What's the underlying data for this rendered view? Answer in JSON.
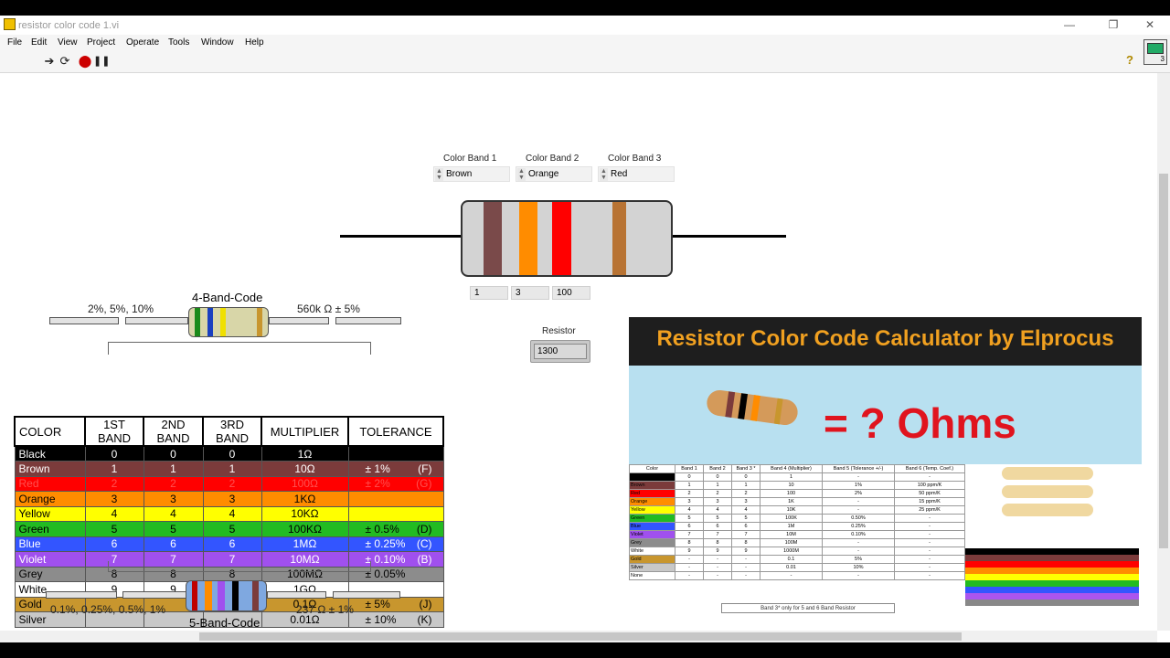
{
  "window": {
    "title": "resistor color code 1.vi"
  },
  "menu": [
    "File",
    "Edit",
    "View",
    "Project",
    "Operate",
    "Tools",
    "Window",
    "Help"
  ],
  "toolbar": {
    "help": "?",
    "vi_icon_num": "3"
  },
  "controls": {
    "band1": {
      "label": "Color Band 1",
      "value": "Brown"
    },
    "band2": {
      "label": "Color Band 2",
      "value": "Orange"
    },
    "band3": {
      "label": "Color Band 3",
      "value": "Red"
    }
  },
  "indicators": [
    "1",
    "3",
    "100"
  ],
  "resistor": {
    "label": "Resistor",
    "value": "1300"
  },
  "colors": {
    "resistor_body": "#d3d3d3",
    "band_positions_colors": [
      "#7a4a4a",
      "#ff8c00",
      "#ff0000",
      "#d3d3d3",
      "#b87333"
    ]
  },
  "four_band": {
    "title": "4-Band-Code",
    "tolerances": "2%, 5%, 10%",
    "example": "560k Ω   ± 5%"
  },
  "five_band": {
    "title": "5-Band-Code",
    "tolerances": "0.1%, 0.25%, 0.5%, 1%",
    "example": "237 Ω   ± 1%"
  },
  "color_table": {
    "headers": [
      "COLOR",
      "1ST BAND",
      "2ND BAND",
      "3RD BAND",
      "MULTIPLIER",
      "TOLERANCE"
    ],
    "rows": [
      {
        "name": "Black",
        "b1": "0",
        "b2": "0",
        "b3": "0",
        "mult": "1Ω",
        "tol": "",
        "code": "",
        "bg": "#000000",
        "fg": "#ffffff"
      },
      {
        "name": "Brown",
        "b1": "1",
        "b2": "1",
        "b3": "1",
        "mult": "10Ω",
        "tol": "± 1%",
        "code": "(F)",
        "bg": "#7b3b3b",
        "fg": "#ffffff"
      },
      {
        "name": "Red",
        "b1": "2",
        "b2": "2",
        "b3": "2",
        "mult": "100Ω",
        "tol": "± 2%",
        "code": "(G)",
        "bg": "#ff0000",
        "fg": "#ff5050"
      },
      {
        "name": "Orange",
        "b1": "3",
        "b2": "3",
        "b3": "3",
        "mult": "1KΩ",
        "tol": "",
        "code": "",
        "bg": "#ff8c00",
        "fg": "#000000"
      },
      {
        "name": "Yellow",
        "b1": "4",
        "b2": "4",
        "b3": "4",
        "mult": "10KΩ",
        "tol": "",
        "code": "",
        "bg": "#ffff00",
        "fg": "#000000"
      },
      {
        "name": "Green",
        "b1": "5",
        "b2": "5",
        "b3": "5",
        "mult": "100KΩ",
        "tol": "± 0.5%",
        "code": "(D)",
        "bg": "#22bb22",
        "fg": "#000000"
      },
      {
        "name": "Blue",
        "b1": "6",
        "b2": "6",
        "b3": "6",
        "mult": "1MΩ",
        "tol": "± 0.25%",
        "code": "(C)",
        "bg": "#3355ff",
        "fg": "#ffffff"
      },
      {
        "name": "Violet",
        "b1": "7",
        "b2": "7",
        "b3": "7",
        "mult": "10MΩ",
        "tol": "± 0.10%",
        "code": "(B)",
        "bg": "#a050ee",
        "fg": "#ffffff"
      },
      {
        "name": "Grey",
        "b1": "8",
        "b2": "8",
        "b3": "8",
        "mult": "100MΩ",
        "tol": "± 0.05%",
        "code": "",
        "bg": "#8c8c8c",
        "fg": "#000000"
      },
      {
        "name": "White",
        "b1": "9",
        "b2": "9",
        "b3": "9",
        "mult": "1GΩ",
        "tol": "",
        "code": "",
        "bg": "#ffffff",
        "fg": "#000000"
      },
      {
        "name": "Gold",
        "b1": "",
        "b2": "",
        "b3": "",
        "mult": "0.1Ω",
        "tol": "± 5%",
        "code": "(J)",
        "bg": "#c8962e",
        "fg": "#000000"
      },
      {
        "name": "Silver",
        "b1": "",
        "b2": "",
        "b3": "",
        "mult": "0.01Ω",
        "tol": "± 10%",
        "code": "(K)",
        "bg": "#c8c8c8",
        "fg": "#000000"
      }
    ]
  },
  "banner": {
    "title": "Resistor Color Code Calculator by Elprocus",
    "equation": "= ? Ohms",
    "mini_headers": [
      "Color",
      "Band 1",
      "Band 2",
      "Band 3 *",
      "Band 4 (Multiplier)",
      "Band 5 (Tolerance +/-)",
      "Band 6 (Temp. Coef.)"
    ],
    "mini_rows": [
      [
        "Black",
        "0",
        "0",
        "0",
        "1",
        "-",
        "-"
      ],
      [
        "Brown",
        "1",
        "1",
        "1",
        "10",
        "1%",
        "100 ppm/K"
      ],
      [
        "Red",
        "2",
        "2",
        "2",
        "100",
        "2%",
        "50 ppm/K"
      ],
      [
        "Orange",
        "3",
        "3",
        "3",
        "1K",
        "-",
        "15 ppm/K"
      ],
      [
        "Yellow",
        "4",
        "4",
        "4",
        "10K",
        "-",
        "25 ppm/K"
      ],
      [
        "Green",
        "5",
        "5",
        "5",
        "100K",
        "0.50%",
        "-"
      ],
      [
        "Blue",
        "6",
        "6",
        "6",
        "1M",
        "0.25%",
        "-"
      ],
      [
        "Violet",
        "7",
        "7",
        "7",
        "10M",
        "0.10%",
        "-"
      ],
      [
        "Grey",
        "8",
        "8",
        "8",
        "100M",
        "-",
        "-"
      ],
      [
        "White",
        "9",
        "9",
        "9",
        "1000M",
        "-",
        "-"
      ],
      [
        "Gold",
        "-",
        "-",
        "-",
        "0.1",
        "5%",
        "-"
      ],
      [
        "Silver",
        "-",
        "-",
        "-",
        "0.01",
        "10%",
        "-"
      ],
      [
        "None",
        "-",
        "-",
        "-",
        "-",
        "-",
        "-"
      ]
    ],
    "mini_colors": [
      "#000000",
      "#7b3b3b",
      "#ff0000",
      "#ff8c00",
      "#ffff00",
      "#22bb22",
      "#3355ff",
      "#a050ee",
      "#8c8c8c",
      "#ffffff",
      "#c8962e",
      "#c8c8c8",
      "#ffffff"
    ],
    "note": "Band 3* only for 5 and 6 Band Resistor"
  }
}
